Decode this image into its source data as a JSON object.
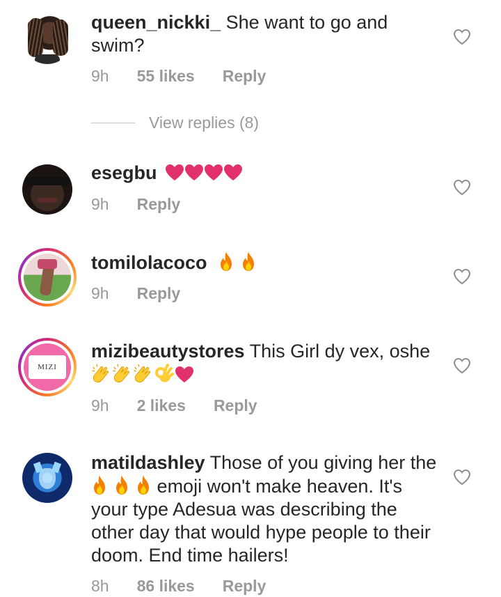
{
  "comments": [
    {
      "username": "queen_nickki_",
      "text": "She want to go and swim?",
      "time": "9h",
      "likes": "55 likes",
      "reply": "Reply",
      "view_replies": "View replies (8)"
    },
    {
      "username": "esegbu",
      "text": "",
      "emojis": [
        "heart",
        "heart",
        "heart",
        "heart"
      ],
      "time": "9h",
      "reply": "Reply"
    },
    {
      "username": "tomilolacoco",
      "text": "",
      "emojis": [
        "fire",
        "fire"
      ],
      "time": "9h",
      "reply": "Reply"
    },
    {
      "username": "mizibeautystores",
      "text": "This Girl dy vex, oshe",
      "emojis": [
        "clap",
        "clap",
        "clap",
        "ok-hand",
        "heart"
      ],
      "avatar_text": "MIZI",
      "time": "9h",
      "likes": "2 likes",
      "reply": "Reply"
    },
    {
      "username": "matildashley",
      "text_before": "Those of you giving her the",
      "emojis": [
        "fire",
        "fire",
        "fire"
      ],
      "text_after": "emoji won't make heaven. It's your type Adesua was describing the other day that would hype people to their doom. End time hailers!",
      "time": "8h",
      "likes": "86 likes",
      "reply": "Reply"
    }
  ],
  "colors": {
    "text": "#262626",
    "muted": "#999999",
    "heart_emoji": "#e1306c",
    "fire_emoji": "#f77f00",
    "clap_emoji": "#ffcc33"
  }
}
